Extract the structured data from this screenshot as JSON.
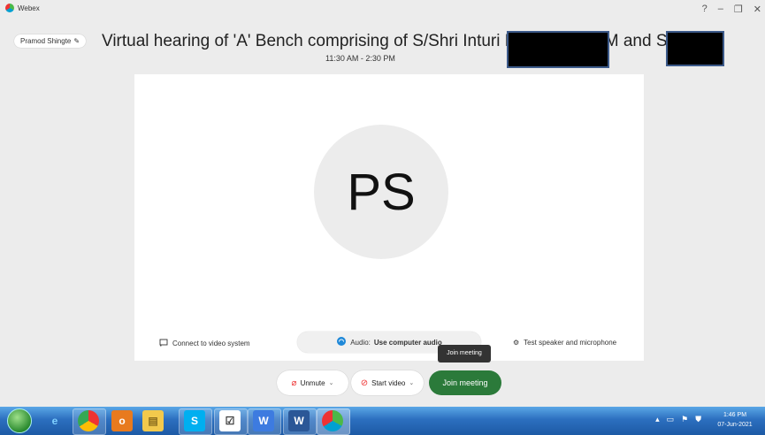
{
  "app": {
    "title": "Webex"
  },
  "window_controls": {
    "help": "?",
    "minimize": "–",
    "maximize": "❐",
    "close": "✕"
  },
  "user": {
    "name": "Pramod Shingte",
    "edit_icon": "pencil-icon"
  },
  "meeting": {
    "title": "Virtual hearing of 'A' Bench comprising of S/Shri Inturi Rama Rao, AM and S.S. Vis",
    "time": "11:30 AM - 2:30 PM"
  },
  "preview": {
    "avatar_initials": "PS",
    "connect_label": "Connect to video system",
    "audio_prefix": "Audio:",
    "audio_value": "Use computer audio",
    "test_label": "Test speaker and microphone"
  },
  "tooltip": "Join meeting",
  "controls": {
    "unmute_label": "Unmute",
    "start_video_label": "Start video",
    "join_label": "Join meeting"
  },
  "taskbar": {
    "clock_time": "1:46 PM",
    "clock_date": "07-Jun-2021"
  },
  "colors": {
    "join_green": "#2b7a3a",
    "taskbar_blue": "#2c6fbf"
  }
}
